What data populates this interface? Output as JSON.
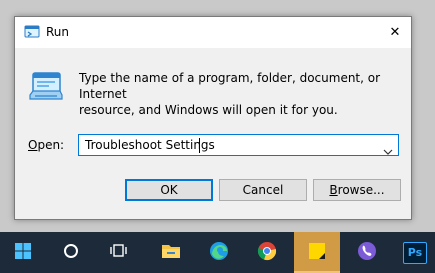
{
  "window": {
    "title": "Run",
    "close_glyph": "✕"
  },
  "dialog": {
    "description_line1": "Type the name of a program, folder, document, or Internet",
    "description_line2": "resource, and Windows will open it for you.",
    "open_label_mnemonic": "O",
    "open_label_rest": "pen:",
    "input_value": "Troubleshoot Settings"
  },
  "buttons": {
    "ok": "OK",
    "cancel": "Cancel",
    "browse_mnemonic": "B",
    "browse_rest": "rowse..."
  },
  "taskbar": {
    "items": [
      {
        "name": "start-icon"
      },
      {
        "name": "cortana-icon"
      },
      {
        "name": "task-view-icon"
      },
      {
        "name": "file-explorer-icon"
      },
      {
        "name": "edge-icon"
      },
      {
        "name": "chrome-icon"
      },
      {
        "name": "sticky-notes-icon"
      },
      {
        "name": "viber-icon"
      },
      {
        "name": "photoshop-icon",
        "label": "Ps"
      }
    ]
  },
  "colors": {
    "accent": "#0078d7",
    "taskbar": "#1c2a3a",
    "active_item": "#d19a44"
  }
}
